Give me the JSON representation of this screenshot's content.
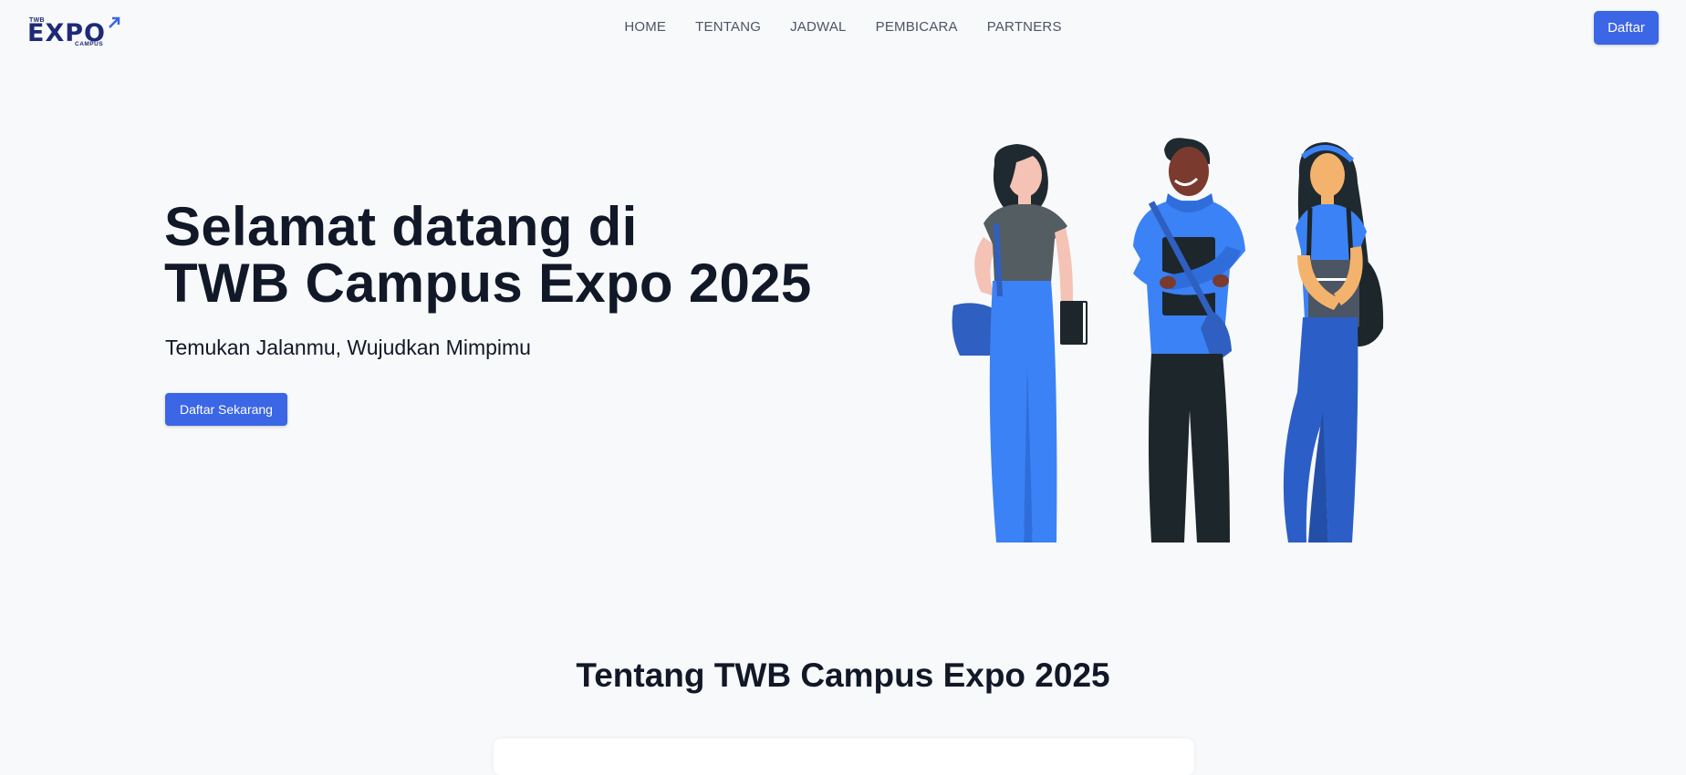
{
  "logo": {
    "top": "TWB",
    "main": "EXPO",
    "sub": "CAMPUS"
  },
  "nav": {
    "links": [
      "HOME",
      "TENTANG",
      "JADWAL",
      "PEMBICARA",
      "PARTNERS"
    ],
    "cta_label": "Daftar"
  },
  "hero": {
    "title_line1": "Selamat datang di",
    "title_line2": "TWB Campus Expo 2025",
    "subtitle": "Temukan Jalanmu, Wujudkan Mimpimu",
    "cta_label": "Daftar Sekarang"
  },
  "about": {
    "title": "Tentang TWB Campus Expo 2025"
  },
  "colors": {
    "primary": "#3b66e5",
    "background": "#f8f9fb",
    "text": "#111827",
    "nav_text": "#4b5563",
    "logo": "#1e2a78"
  }
}
